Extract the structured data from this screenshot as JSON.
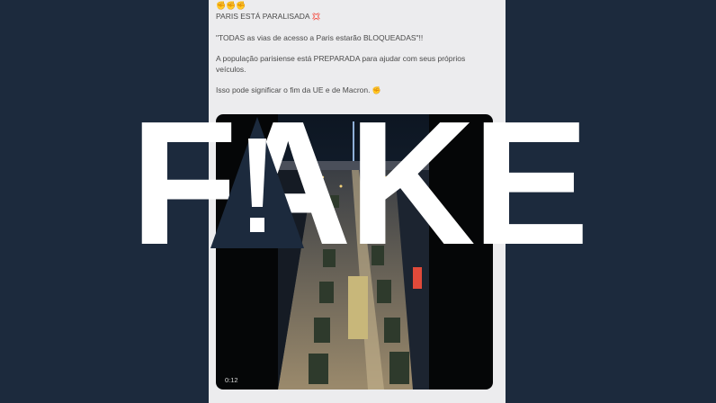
{
  "post": {
    "line_paris": "PARIS ESTÁ PARALISADA",
    "line_todas": "\"TODAS as vias de acesso a Paris estarão BLOQUEADAS\"!!",
    "line_populacao_1": "A população parisiense está PREPARADA para ajudar com seus próprios",
    "line_populacao_2": "veículos.",
    "line_fim": "Isso pode significar o fim da UE e de Macron.",
    "emoji_top": "✊✊✊",
    "emoji_alert": "💢",
    "emoji_fist": "✊"
  },
  "video": {
    "timestamp": "0:12"
  },
  "overlay": {
    "label": "FAKE"
  },
  "colors": {
    "background": "#1c2a3d",
    "card": "#ececee",
    "overlay_text": "#ffffff"
  }
}
